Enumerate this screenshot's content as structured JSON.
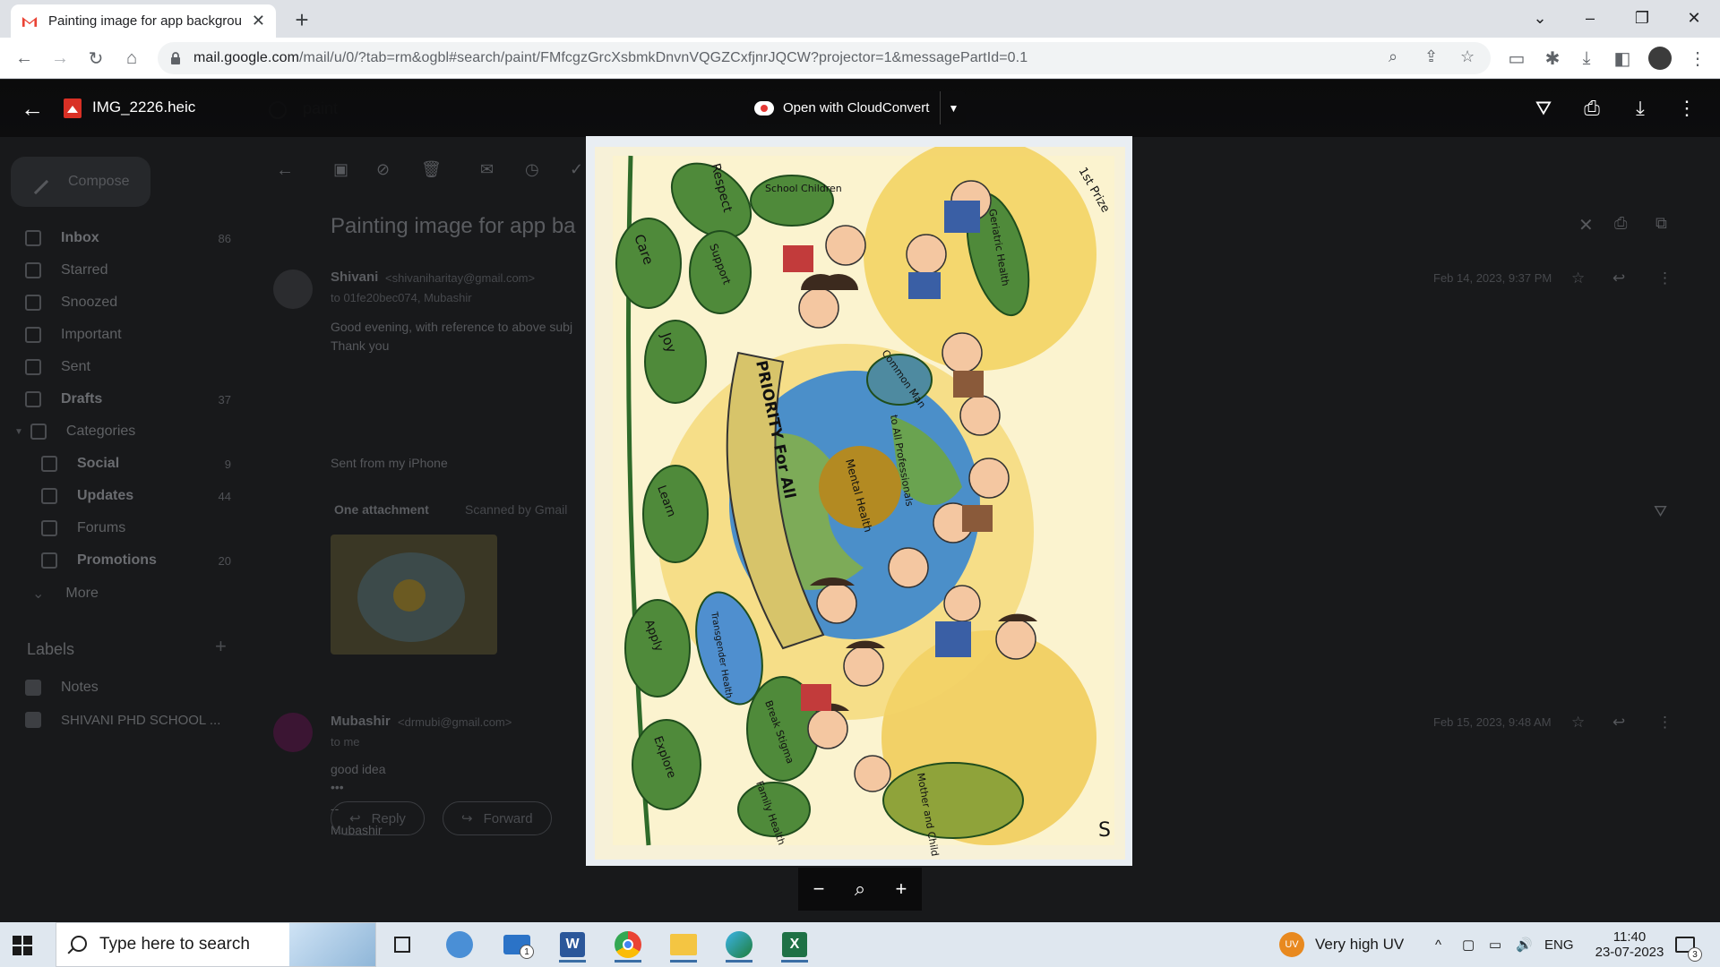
{
  "browser": {
    "tab_title": "Painting image for app backgrou",
    "url_domain": "mail.google.com",
    "url_path": "/mail/u/0/?tab=rm&ogbl#search/paint/FMfcgzGrcXsbmkDnvnVQGZCxfjnrJQCW?projector=1&messagePartId=0.1"
  },
  "gmail": {
    "search_value": "paint",
    "compose_label": "Compose",
    "sidebar": [
      {
        "label": "Inbox",
        "count": "86",
        "bold": true
      },
      {
        "label": "Starred",
        "count": ""
      },
      {
        "label": "Snoozed",
        "count": ""
      },
      {
        "label": "Important",
        "count": ""
      },
      {
        "label": "Sent",
        "count": ""
      },
      {
        "label": "Drafts",
        "count": "37",
        "bold": true
      },
      {
        "label": "Categories",
        "count": ""
      },
      {
        "label": "Social",
        "count": "9",
        "bold": true
      },
      {
        "label": "Updates",
        "count": "44",
        "bold": true
      },
      {
        "label": "Forums",
        "count": ""
      },
      {
        "label": "Promotions",
        "count": "20",
        "bold": true
      },
      {
        "label": "More",
        "count": ""
      }
    ],
    "labels_heading": "Labels",
    "labels": [
      "Notes",
      "SHIVANI PHD SCHOOL ..."
    ],
    "subject": "Painting image for app ba",
    "msg1": {
      "sender": "Shivani",
      "email": "<shivaniharitay@gmail.com>",
      "to": "to 01fe20bec074, Mubashir",
      "date": "Feb 14, 2023, 9:37 PM",
      "body1": "Good evening, with reference to above subj",
      "body2": "Thank you",
      "sig": "Sent from my iPhone"
    },
    "attachments": {
      "label": "One attachment",
      "scanned": "Scanned by Gmail"
    },
    "msg2": {
      "sender": "Mubashir",
      "email": "<drmubi@gmail.com>",
      "to": "to me",
      "date": "Feb 15, 2023, 9:48 AM",
      "body": "good idea",
      "dash": "--",
      "sig": "Mubashir"
    },
    "reply_label": "Reply",
    "forward_label": "Forward"
  },
  "viewer": {
    "file_name": "IMG_2226.heic",
    "open_with_label": "Open with CloudConvert"
  },
  "painting": {
    "corner_note": "1st Prize",
    "leaves": [
      "Respect",
      "Care",
      "Support",
      "Joy",
      "Learn",
      "Apply",
      "Explore",
      "School Children",
      "Geriatric Health",
      "Common Man",
      "Transgender Health",
      "Break Stigma",
      "Family Health",
      "Mother and Child Health"
    ],
    "banner": "PRIORITY For All",
    "center": "Mental Health",
    "arc_text": "to All Professionals",
    "signature": "S"
  },
  "taskbar": {
    "search_placeholder": "Type here to search",
    "weather": "Very high UV",
    "weather_badge": "UV",
    "lang": "ENG",
    "time": "11:40",
    "date": "23-07-2023",
    "mail_badge": "1",
    "notif_badge": "3"
  }
}
